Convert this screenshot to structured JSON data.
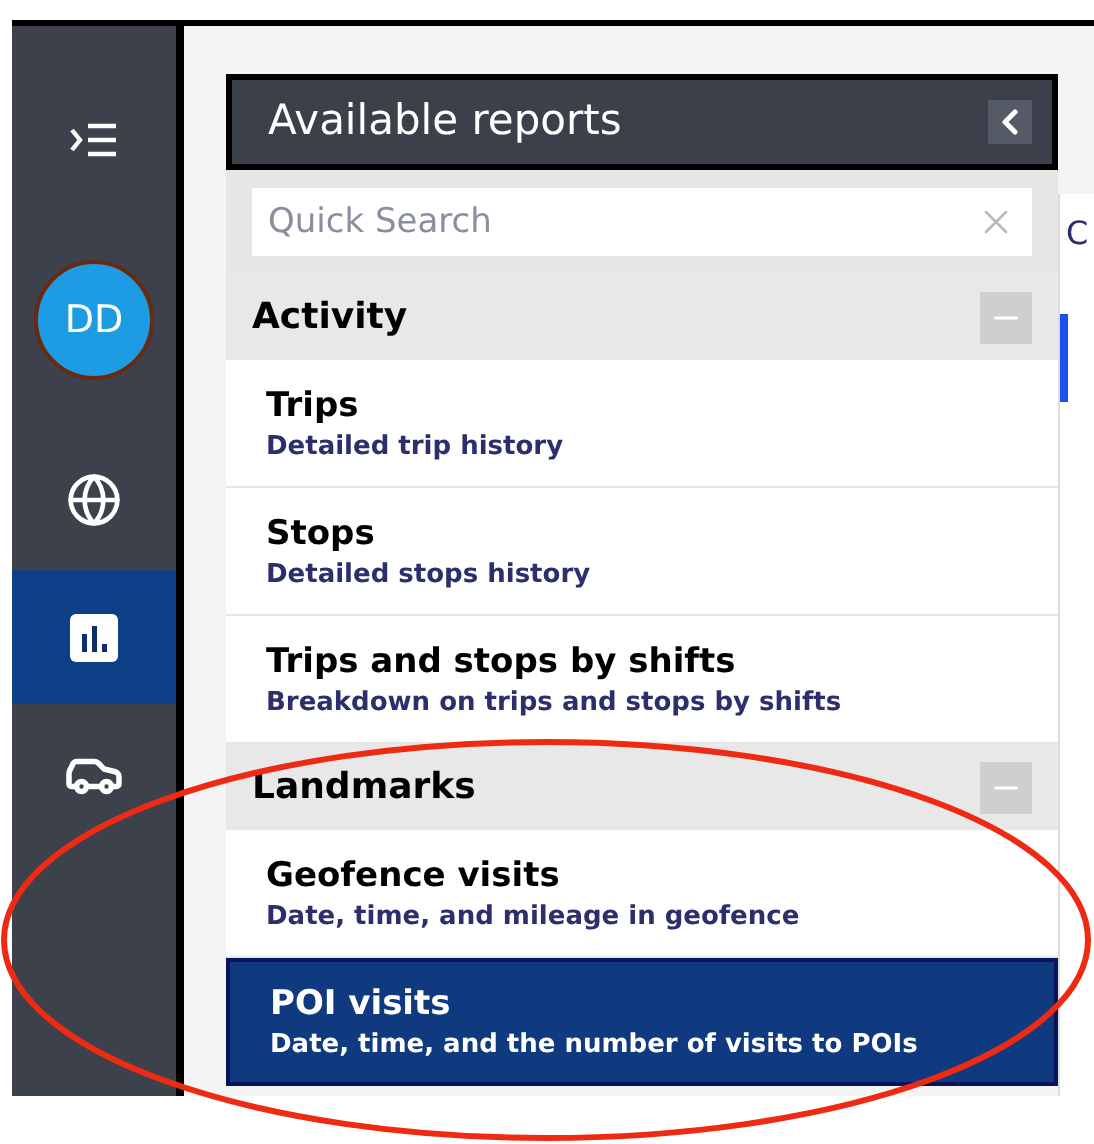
{
  "sidebar": {
    "items": [
      {
        "kind": "menu",
        "selected": false
      },
      {
        "kind": "avatar",
        "label": "DD",
        "selected": false
      },
      {
        "kind": "globe",
        "selected": false
      },
      {
        "kind": "reports",
        "selected": true
      },
      {
        "kind": "vehicle",
        "selected": false
      }
    ]
  },
  "panel": {
    "title": "Available reports",
    "search": {
      "placeholder": "Quick Search"
    },
    "groups": [
      {
        "title": "Activity",
        "expanded": true,
        "reports": [
          {
            "name": "Trips",
            "description": "Detailed trip history",
            "selected": false
          },
          {
            "name": "Stops",
            "description": "Detailed stops history",
            "selected": false
          },
          {
            "name": "Trips and stops by shifts",
            "description": "Breakdown on trips and stops by shifts",
            "selected": false
          }
        ]
      },
      {
        "title": "Landmarks",
        "expanded": true,
        "reports": [
          {
            "name": "Geofence visits",
            "description": "Date, time, and mileage in geofence",
            "selected": false
          },
          {
            "name": "POI visits",
            "description": "Date, time, and the number of visits to POIs",
            "selected": true
          }
        ]
      }
    ]
  },
  "side_panel": {
    "heading": "C"
  }
}
